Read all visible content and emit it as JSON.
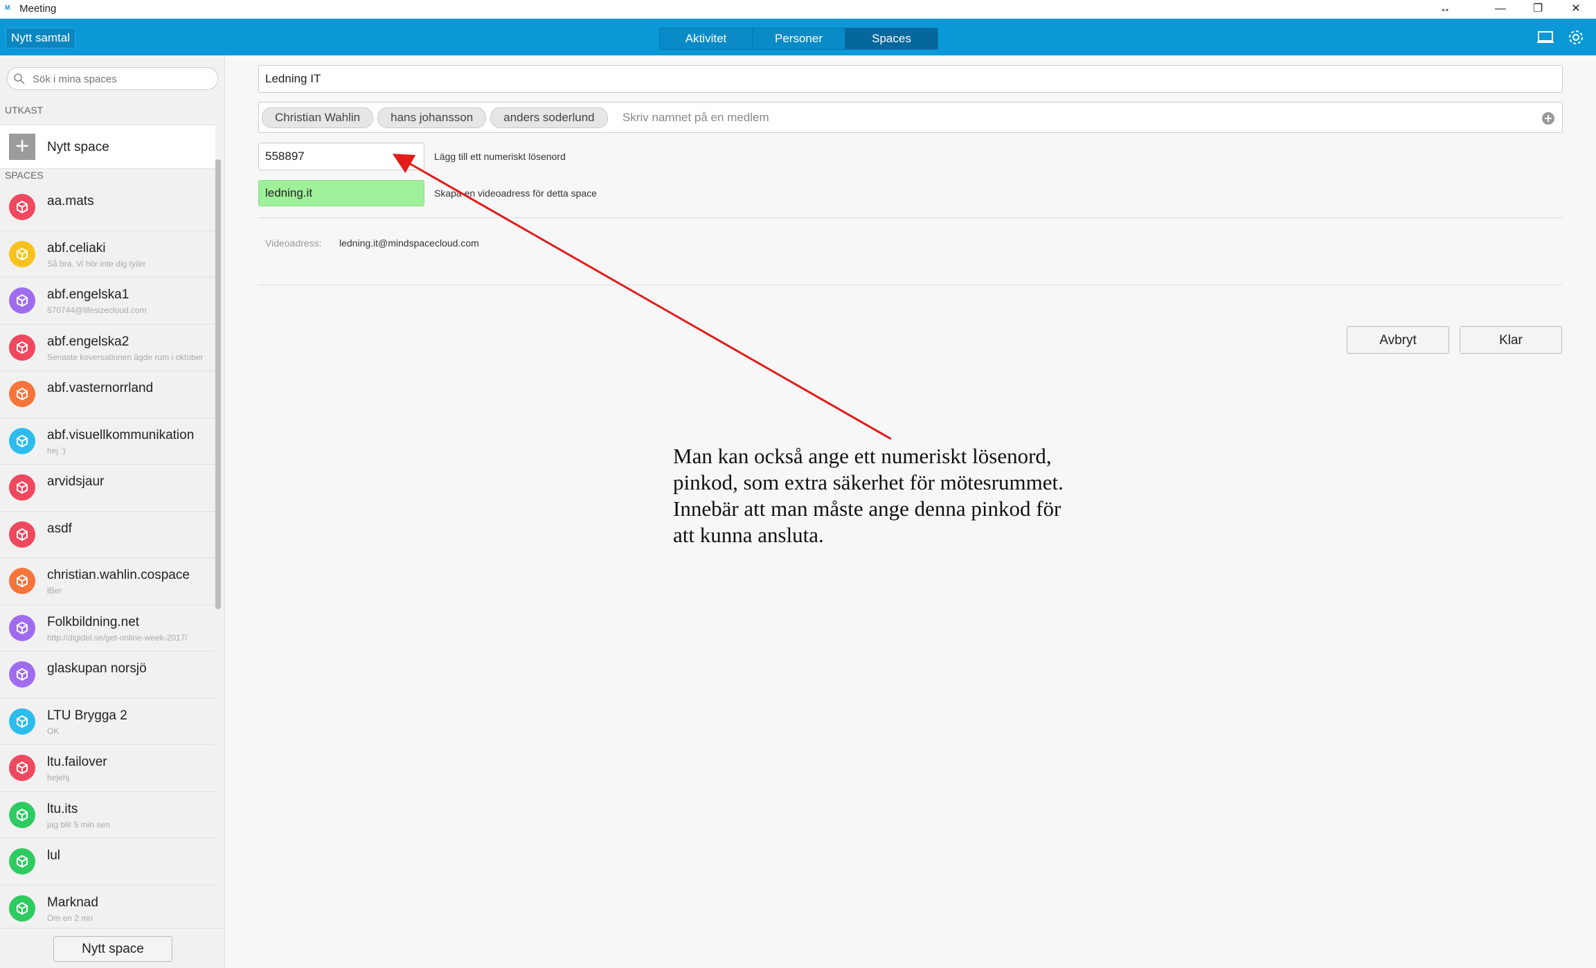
{
  "window": {
    "title": "Meeting",
    "logo_text": "M",
    "controls": [
      "↔",
      "—",
      "❐",
      "✕"
    ]
  },
  "topbar": {
    "new_call_label": "Nytt samtal",
    "tabs": [
      {
        "label": "Aktivitet",
        "active": false
      },
      {
        "label": "Personer",
        "active": false
      },
      {
        "label": "Spaces",
        "active": true
      }
    ],
    "icons": [
      "monitor-icon",
      "gear-icon"
    ]
  },
  "sidebar": {
    "search_placeholder": "Sök i mina spaces",
    "draft_section": "UTKAST",
    "new_space_label": "Nytt space",
    "spaces_section": "SPACES",
    "spaces": [
      {
        "name": "aa.mats",
        "sub": "",
        "color": "#f0485e"
      },
      {
        "name": "abf.celiaki",
        "sub": "Så bra. Vi hör inte dig tyärr",
        "color": "#f8c21a"
      },
      {
        "name": "abf.engelska1",
        "sub": "570744@lifesizecloud.com",
        "color": "#9f6cf0"
      },
      {
        "name": "abf.engelska2",
        "sub": "Senaste koversationen ägde rum i oktober",
        "color": "#f0485e"
      },
      {
        "name": "abf.vasternorrland",
        "sub": "",
        "color": "#f7743a"
      },
      {
        "name": "abf.visuellkommunikation",
        "sub": "hej :)",
        "color": "#2cbcee"
      },
      {
        "name": "arvidsjaur",
        "sub": "",
        "color": "#f0485e"
      },
      {
        "name": "asdf",
        "sub": "",
        "color": "#f0485e"
      },
      {
        "name": "christian.wahlin.cospace",
        "sub": "lBer",
        "color": "#f7743a"
      },
      {
        "name": "Folkbildning.net",
        "sub": "http://digidel.se/get-online-week-2017/",
        "color": "#9f6cf0"
      },
      {
        "name": "glaskupan norsjö",
        "sub": "",
        "color": "#9f6cf0"
      },
      {
        "name": "LTU Brygga 2",
        "sub": "OK",
        "color": "#2cbcee"
      },
      {
        "name": "ltu.failover",
        "sub": "hejehj",
        "color": "#f0485e"
      },
      {
        "name": "ltu.its",
        "sub": "jag blir 5 min sen",
        "color": "#2ecb60"
      },
      {
        "name": "lul",
        "sub": "",
        "color": "#2ecb60"
      },
      {
        "name": "Marknad",
        "sub": "Om en 2 mn",
        "color": "#2ecb60"
      }
    ],
    "footer_button": "Nytt space"
  },
  "form": {
    "space_name": "Ledning IT",
    "members": [
      "Christian Wahlin",
      "hans johansson",
      "anders soderlund"
    ],
    "member_placeholder": "Skriv namnet på en medlem",
    "pin_value": "558897",
    "pin_hint": "Lägg till ett numeriskt lösenord",
    "video_value": "ledning.it",
    "video_hint": "Skapa en videoadress för detta space",
    "video_address_label": "Videoadress:",
    "video_address_value": "ledning.it@mindspacecloud.com",
    "cancel_label": "Avbryt",
    "done_label": "Klar"
  },
  "annotation": {
    "lines": [
      "Man kan också ange ett numeriskt lösenord,",
      "pinkod, som extra säkerhet för mötesrummet.",
      "Innebär att man måste ange denna pinkod för",
      "att kunna ansluta."
    ],
    "arrow_color": "#e31b1b"
  }
}
